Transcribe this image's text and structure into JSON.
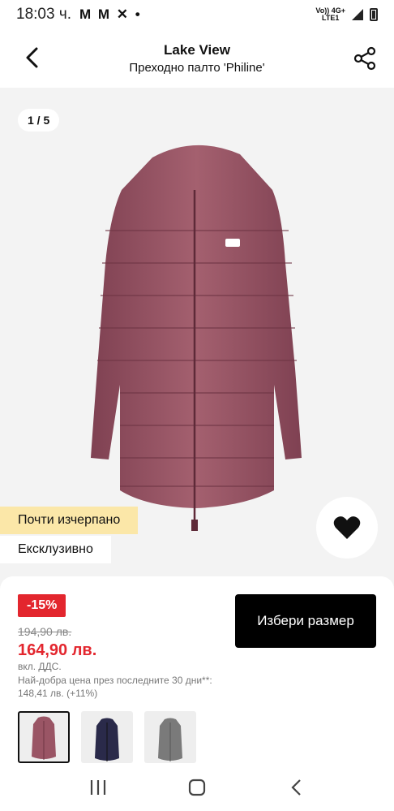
{
  "status": {
    "time": "18:03 ч.",
    "apps": "M M ✕ •",
    "network_top": "Vo)) 4G+",
    "network_bottom": "LTE1"
  },
  "header": {
    "brand": "Lake View",
    "product": "Преходно палто 'Philine'"
  },
  "gallery": {
    "counter": "1 / 5",
    "badge_low_stock": "Почти изчерпано",
    "badge_exclusive": "Ексклузивно"
  },
  "price": {
    "discount": "-15%",
    "old": "194,90 лв.",
    "current": "164,90 лв.",
    "vat": "вкл. ДДС.",
    "best_price_note": "Най-добра цена през последните 30 дни**: 148,41 лв. (+11%)"
  },
  "actions": {
    "select_size": "Избери размер"
  },
  "colors": {
    "accent": "#e3262e",
    "coat_mauve": "#9a5565",
    "coat_navy": "#2a2a4a",
    "coat_grey": "#7a7a7a",
    "badge_yellow": "#fbe7a8"
  }
}
